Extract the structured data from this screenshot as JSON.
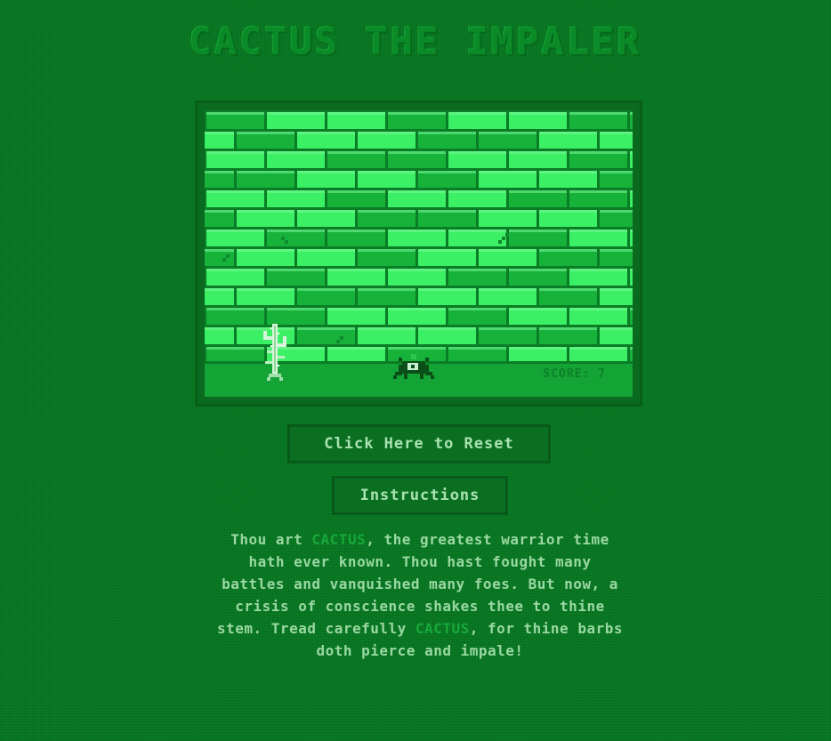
{
  "title": "CACTUS THE IMPALER",
  "game": {
    "score_label": "SCORE: 7"
  },
  "buttons": {
    "reset_label": "Click Here to Reset",
    "instructions_label": "Instructions"
  },
  "story": {
    "part1": "Thou art ",
    "name1": "CACTUS",
    "part2": ", the greatest warrior time hath ever known. Thou hast fought many battles and vanquished many foes. But now, a crisis of conscience shakes thee to thine stem. Tread carefully ",
    "name2": "CACTUS",
    "part3": ", for thine barbs doth pierce and impale!"
  },
  "colors": {
    "background": "#0a7a24",
    "brick_light": "#3cf065",
    "brick_dark": "#17b23a",
    "mortar": "#0a7d26",
    "ground": "#14a335"
  },
  "icons": {
    "player": "cactus-sprite-icon",
    "enemy": "beetle-sprite-icon"
  }
}
